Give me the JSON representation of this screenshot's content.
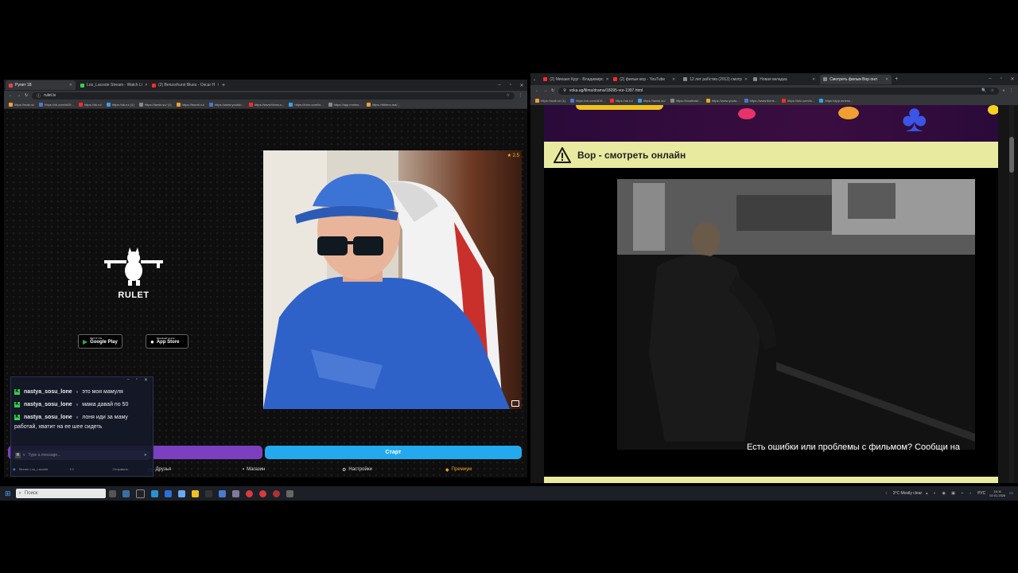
{
  "left_browser": {
    "tabs": [
      {
        "title": "Рулет 18",
        "color": "#e04848",
        "active": true
      },
      {
        "title": "Loo_Lacoste Stream - Watch Li",
        "color": "#36d14f",
        "active": false
      },
      {
        "title": "(2) Benzorhurst Blues - Oscar H",
        "color": "#ff2a2a",
        "active": false
      }
    ],
    "url": "rulet.tv",
    "bookmarks": [
      "https://mail.ru/",
      "https://vk.com/id19...",
      "https://ok.ru/",
      "https://ok.ru/ (1)",
      "https://lamki.su/ (1)",
      "https://kwork.ru/",
      "https://www.youtub...",
      "https://www.ttcms.s...",
      "https://lolzx.com/lo...",
      "https://app.mnimo...",
      "https://diktrno.ma/..."
    ]
  },
  "ruletka": {
    "logo_text": "RULET",
    "viewer_badge": "★ 2.5",
    "google_play": {
      "small": "GET IT ON",
      "label": "Google Play"
    },
    "app_store": {
      "small": "Download on the",
      "label": "App Store"
    },
    "start_button": "Старт",
    "nav": [
      {
        "label": "Друзья",
        "icon": "friends-icon"
      },
      {
        "label": "Магазин",
        "icon": "shop-icon"
      },
      {
        "label": "Настройки",
        "icon": "settings-icon"
      },
      {
        "label": "Премиум",
        "icon": "premium-icon",
        "accent": "#f0a030"
      }
    ]
  },
  "chat": {
    "messages": [
      {
        "user": "nastya_sosu_lone",
        "text": "это моя мамуля"
      },
      {
        "user": "nastya_sosu_lone",
        "text": "мама давай по 50"
      },
      {
        "user": "nastya_sosu_lone",
        "text": "лоня иди за маму"
      }
    ],
    "overflow_text": "работай, хватит на ее шее сидеть",
    "input_placeholder": "Type a message...",
    "footer_left": "Stream Loo_Lacoste",
    "footer_count": "1/1",
    "footer_send": "Отправить"
  },
  "right_browser": {
    "tabs": [
      {
        "title": "(2) Михаил Круг - Владимирс",
        "color": "#ff2a2a",
        "active": false
      },
      {
        "title": "(2) фильм вор - YouTube",
        "color": "#ff2a2a",
        "active": false
      },
      {
        "title": "12 лет рабства (2013) смотр",
        "color": "#888888",
        "active": false
      },
      {
        "title": "Новая вкладка",
        "color": "#888888",
        "active": false
      },
      {
        "title": "Смотреть фильм Вор онл",
        "color": "#888888",
        "active": true
      }
    ],
    "url": "voka.ag/films/drama/18095-vor-1997.html",
    "bookmarks": [
      "https://mail.ru/ (1)",
      "https://vk.com/id19...",
      "https://ok.ru/",
      "https://lamki.su/",
      "https://localhost/...",
      "https://www.youtu...",
      "https://www.ttcms...",
      "https://lolz.com/lo...",
      "https://app.mnimo..."
    ]
  },
  "movie_page": {
    "title": "Вор - смотреть онлайн",
    "warning_color": "#1a1a1a",
    "header_bg": "#e8eaa0",
    "report_text": "Есть ошибки или проблемы с фильмом? Сообщи на"
  },
  "taskbar": {
    "search_placeholder": "Поиск",
    "weather": "3°C  Mostly clear",
    "lang": "РУС",
    "time": "16:11",
    "date": "02.01.2026"
  }
}
